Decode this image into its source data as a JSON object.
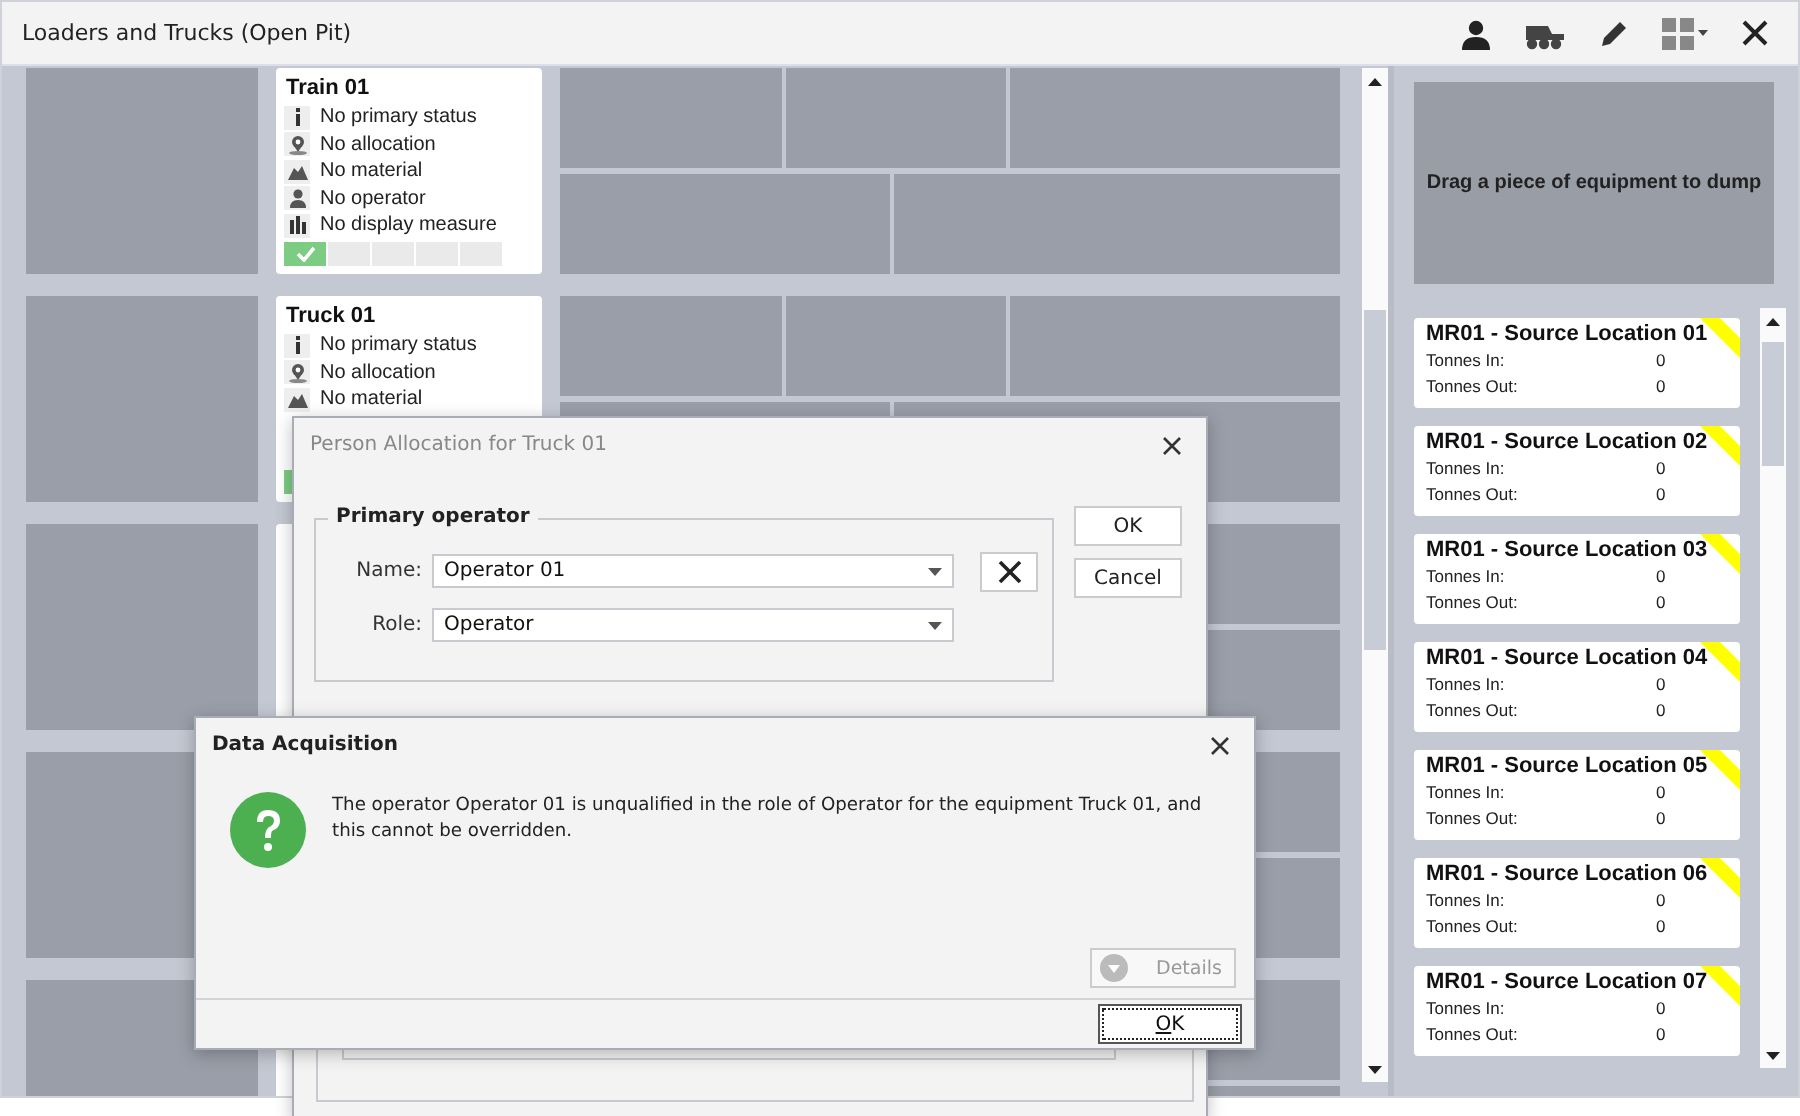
{
  "window": {
    "title": "Loaders and Trucks (Open Pit)"
  },
  "toolbar": [
    {
      "kind": "person"
    },
    {
      "kind": "truck"
    },
    {
      "kind": "pencil"
    },
    {
      "kind": "layout"
    },
    {
      "kind": "close"
    }
  ],
  "equipment_cards": [
    {
      "title": "Train 01",
      "lines": [
        {
          "kind": "status",
          "text": "No primary status"
        },
        {
          "kind": "allocation",
          "text": "No allocation"
        },
        {
          "kind": "material",
          "text": "No material"
        },
        {
          "kind": "operator",
          "text": "No operator"
        },
        {
          "kind": "measure",
          "text": "No display measure"
        }
      ],
      "status_cells": [
        {
          "checked": true
        },
        {
          "checked": false
        },
        {
          "checked": false
        },
        {
          "checked": false
        },
        {
          "checked": false
        }
      ]
    },
    {
      "title": "Truck 01",
      "lines": [
        {
          "kind": "status",
          "text": "No primary status"
        },
        {
          "kind": "allocation",
          "text": "No allocation"
        },
        {
          "kind": "material",
          "text": "No material"
        }
      ],
      "status_cells": [
        {
          "checked": true
        }
      ]
    }
  ],
  "drop_zone": {
    "text": "Drag a piece of equipment to dump"
  },
  "source_locations": [
    {
      "title": "MR01 - Source Location 01",
      "rows": [
        {
          "label": "Tonnes In:",
          "value": "0"
        },
        {
          "label": "Tonnes Out:",
          "value": "0"
        }
      ]
    },
    {
      "title": "MR01 - Source Location 02",
      "rows": [
        {
          "label": "Tonnes In:",
          "value": "0"
        },
        {
          "label": "Tonnes Out:",
          "value": "0"
        }
      ]
    },
    {
      "title": "MR01 - Source Location 03",
      "rows": [
        {
          "label": "Tonnes In:",
          "value": "0"
        },
        {
          "label": "Tonnes Out:",
          "value": "0"
        }
      ]
    },
    {
      "title": "MR01 - Source Location 04",
      "rows": [
        {
          "label": "Tonnes In:",
          "value": "0"
        },
        {
          "label": "Tonnes Out:",
          "value": "0"
        }
      ]
    },
    {
      "title": "MR01 - Source Location 05",
      "rows": [
        {
          "label": "Tonnes In:",
          "value": "0"
        },
        {
          "label": "Tonnes Out:",
          "value": "0"
        }
      ]
    },
    {
      "title": "MR01 - Source Location 06",
      "rows": [
        {
          "label": "Tonnes In:",
          "value": "0"
        },
        {
          "label": "Tonnes Out:",
          "value": "0"
        }
      ]
    },
    {
      "title": "MR01 - Source Location 07",
      "rows": [
        {
          "label": "Tonnes In:",
          "value": "0"
        },
        {
          "label": "Tonnes Out:",
          "value": "0"
        }
      ]
    }
  ],
  "allocation_dialog": {
    "title": "Person Allocation for Truck 01",
    "active": false,
    "group_title": "Primary operator",
    "fields": [
      {
        "label": "Name:",
        "value": "Operator 01",
        "clearable": true
      },
      {
        "label": "Role:",
        "value": "Operator",
        "clearable": false
      }
    ],
    "buttons": [
      "OK",
      "Cancel"
    ]
  },
  "message_dialog": {
    "title": "Data Acquisition",
    "message": "The operator Operator 01 is unqualified in the role of Operator for the equipment Truck 01, and this cannot be overridden.",
    "details": {
      "label": "Details",
      "disabled": true
    },
    "buttons": [
      {
        "label": "OK",
        "focused": true
      }
    ]
  }
}
